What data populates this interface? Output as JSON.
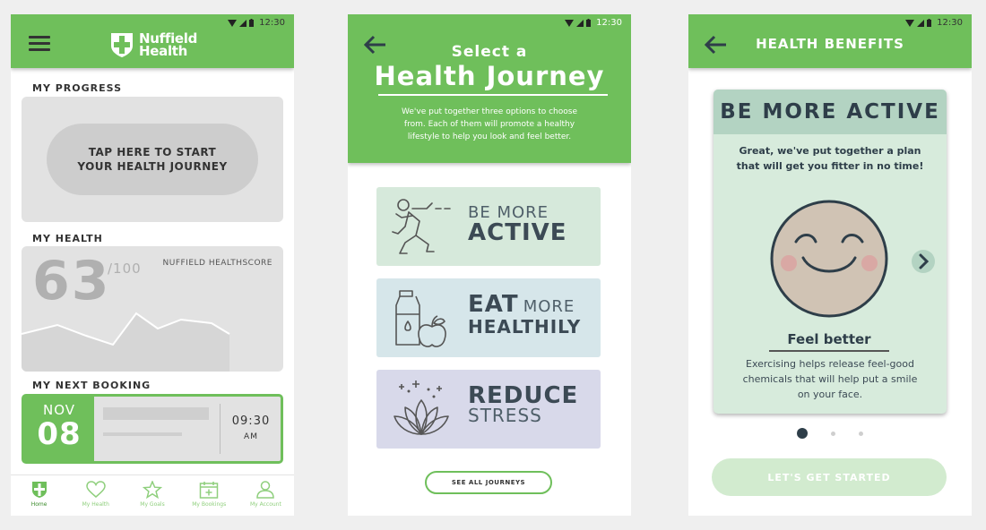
{
  "colors": {
    "brand_green": "#6fbf5b",
    "dark": "#2e3e49",
    "card_grey": "#e2e2e2"
  },
  "status_bar": {
    "time": "12:30"
  },
  "screen_home": {
    "logo_line1": "Nuffield",
    "logo_line2": "Health",
    "progress_label": "MY PROGRESS",
    "start_journey": "TAP HERE TO START\nYOUR HEALTH JOURNEY",
    "health_label": "MY HEALTH",
    "score": "63",
    "score_max": "/100",
    "score_label": "NUFFIELD HEALTHSCORE",
    "booking_label": "MY NEXT BOOKING",
    "booking_month": "NOV",
    "booking_day": "08",
    "booking_time": "09:30",
    "booking_ampm": "AM",
    "tabs": [
      {
        "label": "Home",
        "icon": "shield-icon"
      },
      {
        "label": "My Health",
        "icon": "heart-icon"
      },
      {
        "label": "My Goals",
        "icon": "star-icon"
      },
      {
        "label": "My Bookings",
        "icon": "calendar-icon"
      },
      {
        "label": "My Account",
        "icon": "person-icon"
      }
    ]
  },
  "screen_journey": {
    "title_small": "Select a",
    "title_big": "Health Journey",
    "description": "We've put together three options to choose\nfrom. Each of them will promote a healthy\nlifestyle to help you look and feel better.",
    "options": [
      {
        "line1": "BE MORE",
        "line2": "ACTIVE",
        "icon": "runner-icon"
      },
      {
        "line1a": "EAT",
        "line1b": "MORE",
        "line2": "HEALTHILY",
        "icon": "milk-apple-icon"
      },
      {
        "line1": "REDUCE",
        "line2": "STRESS",
        "icon": "lotus-icon"
      }
    ],
    "see_all": "SEE ALL JOURNEYS"
  },
  "screen_benefits": {
    "title": "HEALTH BENEFITS",
    "card_title": "BE MORE ACTIVE",
    "intro": "Great, we've put together a plan\nthat will get you fitter in no time!",
    "benefit_title": "Feel better",
    "benefit_desc": "Exercising helps release feel-good\nchemicals that will help put a smile\non your face.",
    "cta": "LET'S GET STARTED"
  }
}
